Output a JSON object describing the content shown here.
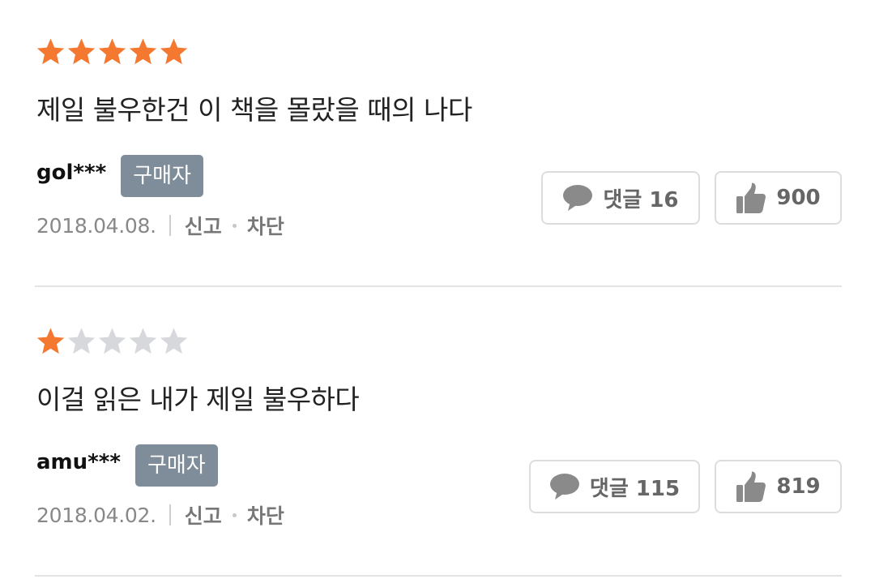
{
  "colors": {
    "star_filled": "#f4782f",
    "star_empty": "#d6d8dc",
    "badge_bg": "#7f8c99",
    "divider": "#e4e4e4"
  },
  "reviews": [
    {
      "rating": 5,
      "max_rating": 5,
      "text": "제일 불우한건 이 책을 몰랐을 때의 나다",
      "username": "gol***",
      "badge": "구매자",
      "date": "2018.04.08.",
      "report_label": "신고",
      "block_label": "차단",
      "comment_label": "댓글 16",
      "like_count": "900"
    },
    {
      "rating": 1,
      "max_rating": 5,
      "text": "이걸 읽은 내가 제일 불우하다",
      "username": "amu***",
      "badge": "구매자",
      "date": "2018.04.02.",
      "report_label": "신고",
      "block_label": "차단",
      "comment_label": "댓글 115",
      "like_count": "819"
    }
  ],
  "icons": {
    "star": "star-icon",
    "comment": "speech-bubble-icon",
    "like": "thumbs-up-icon"
  }
}
